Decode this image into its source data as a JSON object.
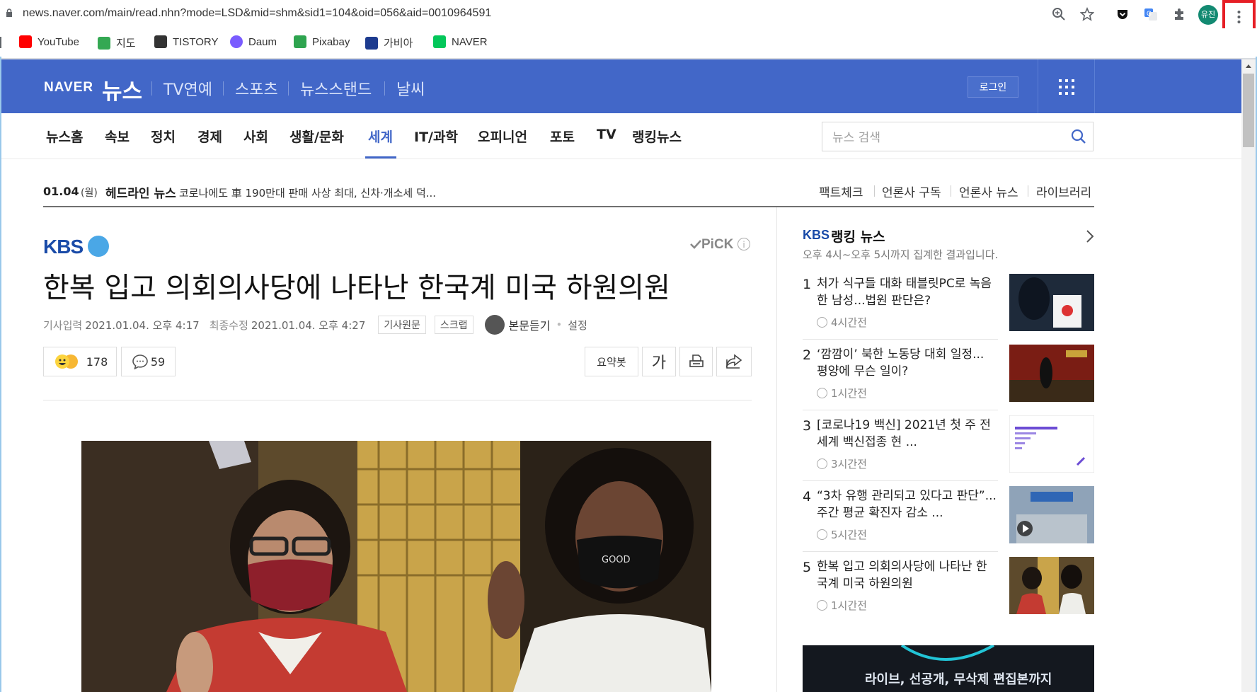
{
  "browser": {
    "url": "news.naver.com/main/read.nhn?mode=LSD&mid=shm&sid1=104&oid=056&aid=0010964591",
    "profile_label": "유진",
    "bookmarks": [
      {
        "label": "YouTube",
        "color": "#ff0000"
      },
      {
        "label": "지도",
        "color": "#34a853"
      },
      {
        "label": "TISTORY",
        "color": "#333333"
      },
      {
        "label": "Daum",
        "color": "#7a5cff"
      },
      {
        "label": "Pixabay",
        "color": "#2ea44f"
      },
      {
        "label": "가비아",
        "color": "#1d3b8f"
      },
      {
        "label": "NAVER",
        "color": "#03c75a"
      }
    ]
  },
  "header": {
    "logo_naver": "NAVER",
    "logo_news": "뉴스",
    "nav": [
      "TV연예",
      "스포츠",
      "뉴스스탠드",
      "날씨"
    ],
    "login_label": "로그인",
    "brand_color": "#4267c8"
  },
  "sections": {
    "items": [
      "뉴스홈",
      "속보",
      "정치",
      "경제",
      "사회",
      "생활/문화",
      "세계",
      "IT/과학",
      "오피니언",
      "포토",
      "TV",
      "랭킹뉴스"
    ],
    "active": "세계",
    "search_placeholder": "뉴스 검색"
  },
  "headline": {
    "date": "01.04",
    "day": "(월)",
    "label": "헤드라인 뉴스",
    "text": "코로나에도 車 190만대 판매 사상 최대, 신차·개소세 덕...",
    "links": [
      "팩트체크",
      "언론사 구독",
      "언론사 뉴스",
      "라이브러리"
    ]
  },
  "article": {
    "press": "KBS",
    "pick": "PiCK",
    "pick_info": "i",
    "title": "한복 입고 의회의사당에 나타난 한국계 미국 하원의원",
    "published_label": "기사입력",
    "published": "2021.01.04. 오후 4:17",
    "modified_label": "최종수정",
    "modified": "2021.01.04. 오후 4:27",
    "original_label": "기사원문",
    "scrap_label": "스크랩",
    "tts_label": "본문듣기",
    "settings_label": "설정",
    "reactions": "178",
    "comments": "59",
    "summary_label": "요약봇",
    "font_label": "가"
  },
  "ranking": {
    "press": "KBS",
    "title": "랭킹 뉴스",
    "subtitle": "오후 4시~오후 5시까지 집계한 결과입니다.",
    "items": [
      {
        "rank": "1",
        "title": "처가 식구들 대화 태블릿PC로 녹음한 남성...법원 판단은?",
        "time": "4시간전"
      },
      {
        "rank": "2",
        "title": "‘깜깜이’ 북한 노동당 대회 일정... 평양에 무슨 일이?",
        "time": "1시간전"
      },
      {
        "rank": "3",
        "title": "[코로나19 백신] 2021년 첫 주 전 세계 백신접종 현 ...",
        "time": "3시간전"
      },
      {
        "rank": "4",
        "title": "“3차 유행 관리되고 있다고 판단”...주간 평균 확진자 감소 ...",
        "time": "5시간전"
      },
      {
        "rank": "5",
        "title": "한복 입고 의회의사당에 나타난 한국계 미국 하원의원",
        "time": "1시간전"
      }
    ]
  },
  "banner": {
    "text": "라이브, 선공개, 무삭제 편집본까지"
  }
}
